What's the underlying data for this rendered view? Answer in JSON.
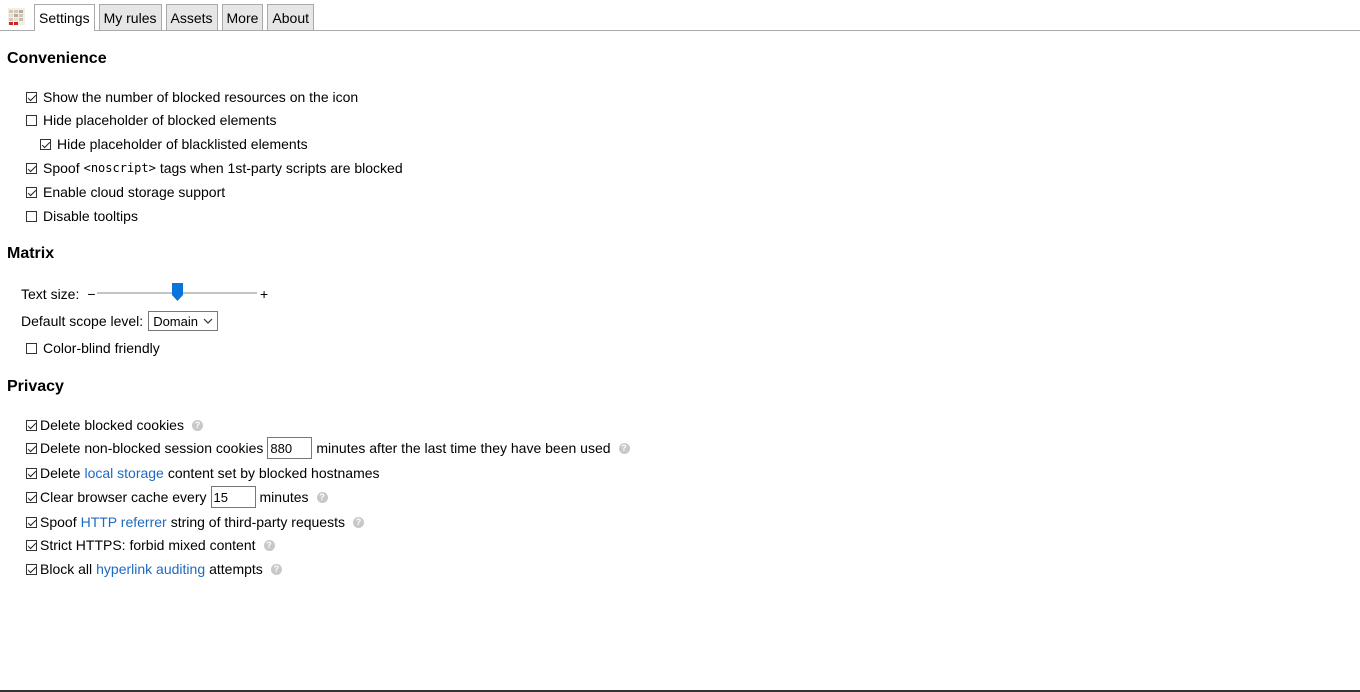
{
  "tabs": [
    "Settings",
    "My rules",
    "Assets",
    "More",
    "About"
  ],
  "sections": {
    "convenience": {
      "title": "Convenience",
      "items": [
        {
          "label": "Show the number of blocked resources on the icon",
          "checked": true
        },
        {
          "label": "Hide placeholder of blocked elements",
          "checked": false
        },
        {
          "label": "Hide placeholder of blacklisted elements",
          "checked": true
        },
        {
          "label_pre": "Spoof",
          "label_code": "<noscript>",
          "label_post": "tags when 1st-party scripts are blocked",
          "checked": true
        },
        {
          "label": "Enable cloud storage support",
          "checked": true
        },
        {
          "label": "Disable tooltips",
          "checked": false
        }
      ]
    },
    "matrix": {
      "title": "Matrix",
      "text_size_label": "Text size:",
      "slider_minus": "−",
      "slider_plus": "+",
      "slider_value": 0.5,
      "scope_label": "Default scope level:",
      "scope_value": "Domain",
      "colorblind_label": "Color-blind friendly",
      "colorblind_checked": false
    },
    "privacy": {
      "title": "Privacy",
      "items": [
        {
          "label": "Delete blocked cookies",
          "checked": true
        },
        {
          "pre": "Delete non-blocked session cookies",
          "value": "880",
          "post": "minutes after the last time they have been used",
          "checked": true
        },
        {
          "pre": "Delete",
          "link": "local storage",
          "post": "content set by blocked hostnames",
          "checked": true
        },
        {
          "pre": "Clear browser cache every",
          "value": "15",
          "post": "minutes",
          "checked": true
        },
        {
          "pre": "Spoof",
          "link": "HTTP referrer",
          "post": "string of third-party requests",
          "checked": true
        },
        {
          "label": "Strict HTTPS: forbid mixed content",
          "checked": true
        },
        {
          "pre": "Block all",
          "link": "hyperlink auditing",
          "post": "attempts",
          "checked": true
        }
      ]
    }
  },
  "help_glyph": "?",
  "colors": {
    "link": "#1c6ac2",
    "slider_thumb": "#0a74d8"
  }
}
